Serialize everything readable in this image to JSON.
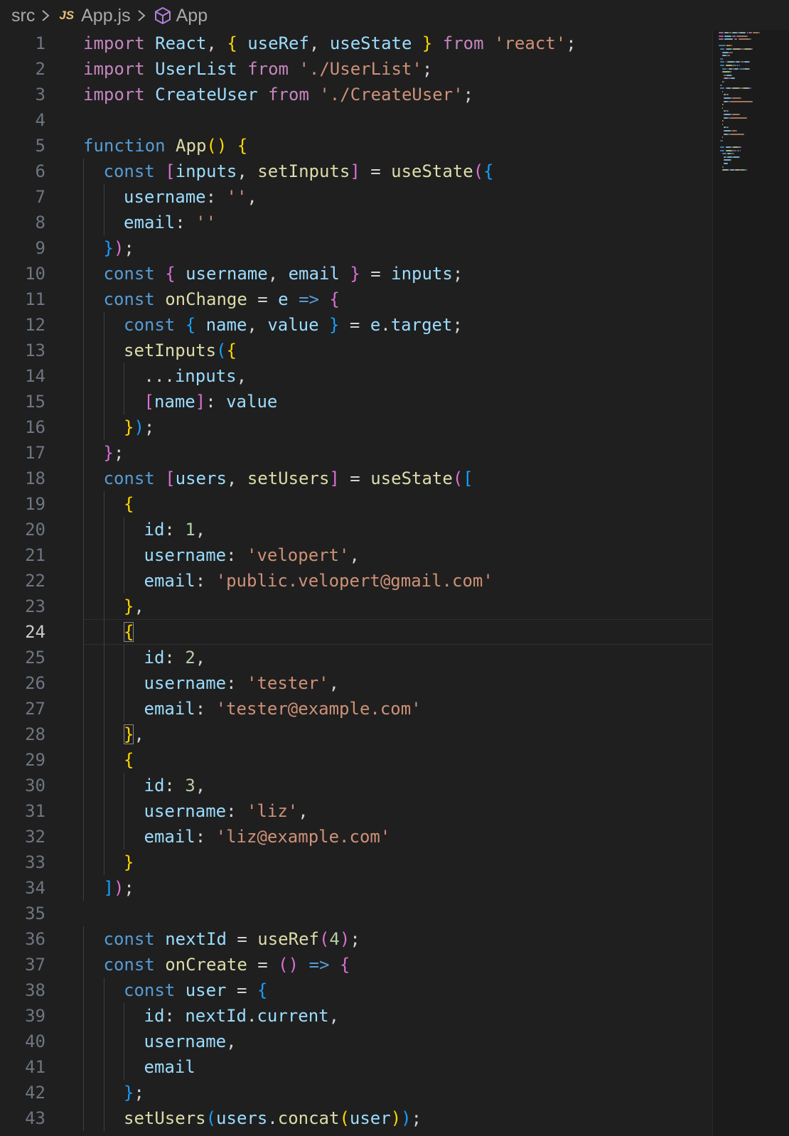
{
  "breadcrumb": {
    "folder": "src",
    "file_badge": "JS",
    "file": "App.js",
    "symbol": "App",
    "icons": [
      "chevron-right-icon",
      "js-file-icon",
      "symbol-cube-icon"
    ]
  },
  "editor": {
    "current_line": 24,
    "colors": {
      "keyword": "#569cd6",
      "control": "#c586c0",
      "function": "#dcdcaa",
      "variable": "#9cdcfe",
      "string": "#ce9178",
      "number": "#b5cea8",
      "bracket1": "#ffd700",
      "bracket2": "#da70d6",
      "bracket3": "#179fff",
      "class": "#4ec9b0",
      "punct": "#d4d4d4",
      "background": "#1f1f1f"
    },
    "lines": [
      {
        "n": "1",
        "indent": 0,
        "tokens": [
          [
            "ctl",
            "import"
          ],
          [
            "p",
            " "
          ],
          [
            "var",
            "React"
          ],
          [
            "p",
            ", "
          ],
          [
            "b1",
            "{"
          ],
          [
            "p",
            " "
          ],
          [
            "var",
            "useRef"
          ],
          [
            "p",
            ", "
          ],
          [
            "var",
            "useState"
          ],
          [
            "p",
            " "
          ],
          [
            "b1",
            "}"
          ],
          [
            "p",
            " "
          ],
          [
            "ctl",
            "from"
          ],
          [
            "p",
            " "
          ],
          [
            "str",
            "'react'"
          ],
          [
            "p",
            ";"
          ]
        ]
      },
      {
        "n": "2",
        "indent": 0,
        "tokens": [
          [
            "ctl",
            "import"
          ],
          [
            "p",
            " "
          ],
          [
            "var",
            "UserList"
          ],
          [
            "p",
            " "
          ],
          [
            "ctl",
            "from"
          ],
          [
            "p",
            " "
          ],
          [
            "str",
            "'./UserList'"
          ],
          [
            "p",
            ";"
          ]
        ]
      },
      {
        "n": "3",
        "indent": 0,
        "tokens": [
          [
            "ctl",
            "import"
          ],
          [
            "p",
            " "
          ],
          [
            "var",
            "CreateUser"
          ],
          [
            "p",
            " "
          ],
          [
            "ctl",
            "from"
          ],
          [
            "p",
            " "
          ],
          [
            "str",
            "'./CreateUser'"
          ],
          [
            "p",
            ";"
          ]
        ]
      },
      {
        "n": "4",
        "indent": 0,
        "tokens": []
      },
      {
        "n": "5",
        "indent": 0,
        "tokens": [
          [
            "kw",
            "function"
          ],
          [
            "p",
            " "
          ],
          [
            "fn",
            "App"
          ],
          [
            "b1",
            "()"
          ],
          [
            "p",
            " "
          ],
          [
            "b1",
            "{"
          ]
        ]
      },
      {
        "n": "6",
        "indent": 1,
        "tokens": [
          [
            "kw",
            "const"
          ],
          [
            "p",
            " "
          ],
          [
            "b2",
            "["
          ],
          [
            "var",
            "inputs"
          ],
          [
            "p",
            ", "
          ],
          [
            "fn",
            "setInputs"
          ],
          [
            "b2",
            "]"
          ],
          [
            "p",
            " = "
          ],
          [
            "fn",
            "useState"
          ],
          [
            "b2",
            "("
          ],
          [
            "b3",
            "{"
          ]
        ]
      },
      {
        "n": "7",
        "indent": 2,
        "tokens": [
          [
            "prop",
            "username"
          ],
          [
            "p",
            ": "
          ],
          [
            "str",
            "''"
          ],
          [
            "p",
            ","
          ]
        ]
      },
      {
        "n": "8",
        "indent": 2,
        "tokens": [
          [
            "prop",
            "email"
          ],
          [
            "p",
            ": "
          ],
          [
            "str",
            "''"
          ]
        ]
      },
      {
        "n": "9",
        "indent": 1,
        "tokens": [
          [
            "b3",
            "}"
          ],
          [
            "b2",
            ")"
          ],
          [
            "p",
            ";"
          ]
        ]
      },
      {
        "n": "10",
        "indent": 1,
        "tokens": [
          [
            "kw",
            "const"
          ],
          [
            "p",
            " "
          ],
          [
            "b2",
            "{"
          ],
          [
            "p",
            " "
          ],
          [
            "var",
            "username"
          ],
          [
            "p",
            ", "
          ],
          [
            "var",
            "email"
          ],
          [
            "p",
            " "
          ],
          [
            "b2",
            "}"
          ],
          [
            "p",
            " = "
          ],
          [
            "var",
            "inputs"
          ],
          [
            "p",
            ";"
          ]
        ]
      },
      {
        "n": "11",
        "indent": 1,
        "tokens": [
          [
            "kw",
            "const"
          ],
          [
            "p",
            " "
          ],
          [
            "fn",
            "onChange"
          ],
          [
            "p",
            " = "
          ],
          [
            "var",
            "e"
          ],
          [
            "p",
            " "
          ],
          [
            "kw",
            "=>"
          ],
          [
            "p",
            " "
          ],
          [
            "b2",
            "{"
          ]
        ]
      },
      {
        "n": "12",
        "indent": 2,
        "tokens": [
          [
            "kw",
            "const"
          ],
          [
            "p",
            " "
          ],
          [
            "b3",
            "{"
          ],
          [
            "p",
            " "
          ],
          [
            "var",
            "name"
          ],
          [
            "p",
            ", "
          ],
          [
            "var",
            "value"
          ],
          [
            "p",
            " "
          ],
          [
            "b3",
            "}"
          ],
          [
            "p",
            " = "
          ],
          [
            "var",
            "e"
          ],
          [
            "p",
            "."
          ],
          [
            "var",
            "target"
          ],
          [
            "p",
            ";"
          ]
        ]
      },
      {
        "n": "13",
        "indent": 2,
        "tokens": [
          [
            "fn",
            "setInputs"
          ],
          [
            "b3",
            "("
          ],
          [
            "b1",
            "{"
          ]
        ]
      },
      {
        "n": "14",
        "indent": 3,
        "tokens": [
          [
            "p",
            "..."
          ],
          [
            "var",
            "inputs"
          ],
          [
            "p",
            ","
          ]
        ]
      },
      {
        "n": "15",
        "indent": 3,
        "tokens": [
          [
            "b2",
            "["
          ],
          [
            "var",
            "name"
          ],
          [
            "b2",
            "]"
          ],
          [
            "p",
            ": "
          ],
          [
            "var",
            "value"
          ]
        ]
      },
      {
        "n": "16",
        "indent": 2,
        "tokens": [
          [
            "b1",
            "}"
          ],
          [
            "b3",
            ")"
          ],
          [
            "p",
            ";"
          ]
        ]
      },
      {
        "n": "17",
        "indent": 1,
        "tokens": [
          [
            "b2",
            "}"
          ],
          [
            "p",
            ";"
          ]
        ]
      },
      {
        "n": "18",
        "indent": 1,
        "tokens": [
          [
            "kw",
            "const"
          ],
          [
            "p",
            " "
          ],
          [
            "b2",
            "["
          ],
          [
            "var",
            "users"
          ],
          [
            "p",
            ", "
          ],
          [
            "fn",
            "setUsers"
          ],
          [
            "b2",
            "]"
          ],
          [
            "p",
            " = "
          ],
          [
            "fn",
            "useState"
          ],
          [
            "b2",
            "("
          ],
          [
            "b3",
            "["
          ]
        ]
      },
      {
        "n": "19",
        "indent": 2,
        "tokens": [
          [
            "b1",
            "{"
          ]
        ]
      },
      {
        "n": "20",
        "indent": 3,
        "tokens": [
          [
            "prop",
            "id"
          ],
          [
            "p",
            ": "
          ],
          [
            "num",
            "1"
          ],
          [
            "p",
            ","
          ]
        ]
      },
      {
        "n": "21",
        "indent": 3,
        "tokens": [
          [
            "prop",
            "username"
          ],
          [
            "p",
            ": "
          ],
          [
            "str",
            "'velopert'"
          ],
          [
            "p",
            ","
          ]
        ]
      },
      {
        "n": "22",
        "indent": 3,
        "tokens": [
          [
            "prop",
            "email"
          ],
          [
            "p",
            ": "
          ],
          [
            "str",
            "'public.velopert@gmail.com'"
          ]
        ]
      },
      {
        "n": "23",
        "indent": 2,
        "tokens": [
          [
            "b1",
            "}"
          ],
          [
            "p",
            ","
          ]
        ]
      },
      {
        "n": "24",
        "indent": 2,
        "tokens": [
          [
            "b1m",
            "{"
          ]
        ]
      },
      {
        "n": "25",
        "indent": 3,
        "tokens": [
          [
            "prop",
            "id"
          ],
          [
            "p",
            ": "
          ],
          [
            "num",
            "2"
          ],
          [
            "p",
            ","
          ]
        ]
      },
      {
        "n": "26",
        "indent": 3,
        "tokens": [
          [
            "prop",
            "username"
          ],
          [
            "p",
            ": "
          ],
          [
            "str",
            "'tester'"
          ],
          [
            "p",
            ","
          ]
        ]
      },
      {
        "n": "27",
        "indent": 3,
        "tokens": [
          [
            "prop",
            "email"
          ],
          [
            "p",
            ": "
          ],
          [
            "str",
            "'tester@example.com'"
          ]
        ]
      },
      {
        "n": "28",
        "indent": 2,
        "tokens": [
          [
            "b1m",
            "}"
          ],
          [
            "p",
            ","
          ]
        ]
      },
      {
        "n": "29",
        "indent": 2,
        "tokens": [
          [
            "b1",
            "{"
          ]
        ]
      },
      {
        "n": "30",
        "indent": 3,
        "tokens": [
          [
            "prop",
            "id"
          ],
          [
            "p",
            ": "
          ],
          [
            "num",
            "3"
          ],
          [
            "p",
            ","
          ]
        ]
      },
      {
        "n": "31",
        "indent": 3,
        "tokens": [
          [
            "prop",
            "username"
          ],
          [
            "p",
            ": "
          ],
          [
            "str",
            "'liz'"
          ],
          [
            "p",
            ","
          ]
        ]
      },
      {
        "n": "32",
        "indent": 3,
        "tokens": [
          [
            "prop",
            "email"
          ],
          [
            "p",
            ": "
          ],
          [
            "str",
            "'liz@example.com'"
          ]
        ]
      },
      {
        "n": "33",
        "indent": 2,
        "tokens": [
          [
            "b1",
            "}"
          ]
        ]
      },
      {
        "n": "34",
        "indent": 1,
        "tokens": [
          [
            "b3",
            "]"
          ],
          [
            "b2",
            ")"
          ],
          [
            "p",
            ";"
          ]
        ]
      },
      {
        "n": "35",
        "indent": 0,
        "tokens": []
      },
      {
        "n": "36",
        "indent": 1,
        "tokens": [
          [
            "kw",
            "const"
          ],
          [
            "p",
            " "
          ],
          [
            "var",
            "nextId"
          ],
          [
            "p",
            " = "
          ],
          [
            "fn",
            "useRef"
          ],
          [
            "b2",
            "("
          ],
          [
            "num",
            "4"
          ],
          [
            "b2",
            ")"
          ],
          [
            "p",
            ";"
          ]
        ]
      },
      {
        "n": "37",
        "indent": 1,
        "tokens": [
          [
            "kw",
            "const"
          ],
          [
            "p",
            " "
          ],
          [
            "fn",
            "onCreate"
          ],
          [
            "p",
            " = "
          ],
          [
            "b2",
            "()"
          ],
          [
            "p",
            " "
          ],
          [
            "kw",
            "=>"
          ],
          [
            "p",
            " "
          ],
          [
            "b2",
            "{"
          ]
        ]
      },
      {
        "n": "38",
        "indent": 2,
        "tokens": [
          [
            "kw",
            "const"
          ],
          [
            "p",
            " "
          ],
          [
            "var",
            "user"
          ],
          [
            "p",
            " = "
          ],
          [
            "b3",
            "{"
          ]
        ]
      },
      {
        "n": "39",
        "indent": 3,
        "tokens": [
          [
            "prop",
            "id"
          ],
          [
            "p",
            ": "
          ],
          [
            "var",
            "nextId"
          ],
          [
            "p",
            "."
          ],
          [
            "var",
            "current"
          ],
          [
            "p",
            ","
          ]
        ]
      },
      {
        "n": "40",
        "indent": 3,
        "tokens": [
          [
            "var",
            "username"
          ],
          [
            "p",
            ","
          ]
        ]
      },
      {
        "n": "41",
        "indent": 3,
        "tokens": [
          [
            "var",
            "email"
          ]
        ]
      },
      {
        "n": "42",
        "indent": 2,
        "tokens": [
          [
            "b3",
            "}"
          ],
          [
            "p",
            ";"
          ]
        ]
      },
      {
        "n": "43",
        "indent": 2,
        "tokens": [
          [
            "fn",
            "setUsers"
          ],
          [
            "b3",
            "("
          ],
          [
            "var",
            "users"
          ],
          [
            "p",
            "."
          ],
          [
            "fn",
            "concat"
          ],
          [
            "b1",
            "("
          ],
          [
            "var",
            "user"
          ],
          [
            "b1",
            ")"
          ],
          [
            "b3",
            ")"
          ],
          [
            "p",
            ";"
          ]
        ]
      }
    ]
  }
}
